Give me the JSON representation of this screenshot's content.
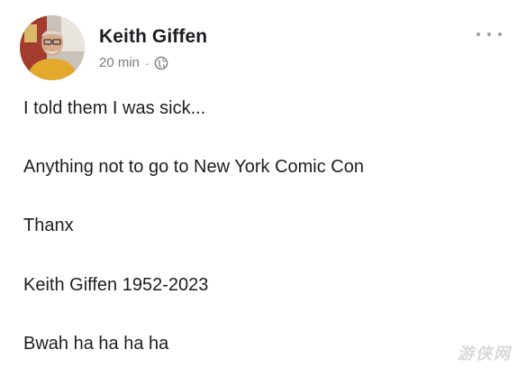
{
  "post": {
    "author": "Keith Giffen",
    "timestamp": "20 min",
    "separator": "·",
    "audience_icon": "globe-icon",
    "more_icon": "more-options-icon",
    "lines": [
      "I told them I was sick...",
      "Anything not to go to New York Comic Con",
      "Thanx",
      "Keith Giffen 1952-2023",
      "Bwah ha ha ha ha"
    ]
  },
  "watermark": {
    "text": "游侠网"
  },
  "colors": {
    "text": "#1c1e21",
    "meta": "#777b80",
    "background": "#ffffff"
  }
}
